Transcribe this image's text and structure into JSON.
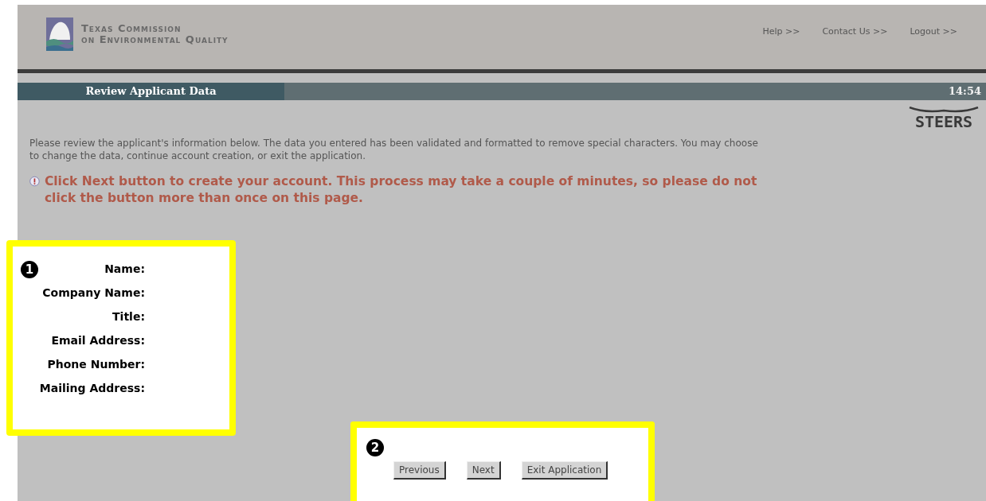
{
  "header": {
    "logo_lines": [
      "Texas Commission",
      "on Environmental Quality"
    ],
    "links": [
      "Help >>",
      "Contact Us >>",
      "Logout >>"
    ]
  },
  "title_bar": {
    "title": "Review Applicant Data",
    "time": "14:54"
  },
  "brand": "STEERS",
  "intro": "Please review the applicant's information below. The data you entered has been validated and formatted to remove special characters. You may choose to change the data, continue account creation, or exit the application.",
  "warning": "Click Next button to create your account. This process may take a couple of minutes, so please do not click the button more than once on this page.",
  "callouts": [
    {
      "number": "1",
      "labels": [
        "Name:",
        "Company Name:",
        "Title:",
        "Email Address:",
        "Phone Number:",
        "Mailing Address:"
      ]
    },
    {
      "number": "2",
      "buttons": [
        "Previous",
        "Next",
        "Exit Application"
      ]
    }
  ]
}
